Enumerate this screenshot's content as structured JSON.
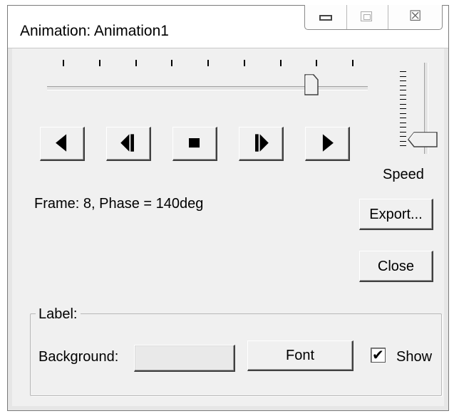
{
  "window": {
    "title": "Animation: Animation1",
    "controls": [
      "minimize",
      "maximize",
      "close"
    ],
    "close_glyph": "☒"
  },
  "frame_slider": {
    "tick_count": 9,
    "position_fraction": 0.86
  },
  "transport": {
    "buttons": [
      {
        "name": "play-backward-button",
        "icon": "play-backward-icon"
      },
      {
        "name": "step-backward-button",
        "icon": "step-backward-icon"
      },
      {
        "name": "stop-button",
        "icon": "stop-icon"
      },
      {
        "name": "step-forward-button",
        "icon": "step-forward-icon"
      },
      {
        "name": "play-forward-button",
        "icon": "play-forward-icon"
      }
    ]
  },
  "speed": {
    "label": "Speed",
    "position_fraction": 0.92
  },
  "status": {
    "frame_text": "Frame: 8, Phase = 140deg"
  },
  "buttons": {
    "export_label": "Export...",
    "close_label": "Close"
  },
  "label_group": {
    "legend": "Label:",
    "background_label": "Background:",
    "background_color": "#e9e9e9",
    "font_label": "Font",
    "show_label": "Show",
    "show_checked": true,
    "check_glyph": "✔"
  }
}
